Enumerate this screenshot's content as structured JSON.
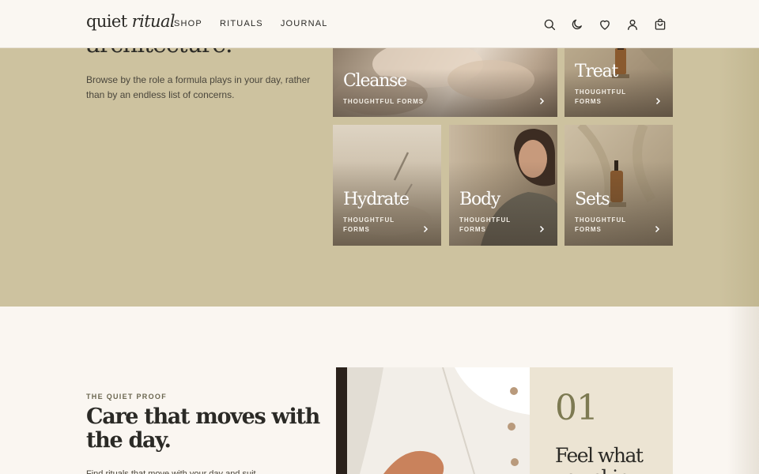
{
  "brand": {
    "name_plain": "quiet ",
    "name_italic": "ritual"
  },
  "nav": {
    "items": [
      "SHOP",
      "RITUALS",
      "JOURNAL"
    ]
  },
  "header_icons": [
    "search-icon",
    "moon-icon",
    "heart-icon",
    "user-icon",
    "bag-icon"
  ],
  "category_section": {
    "heading_fragment": "architecture.",
    "intro": "Browse by the role a formula plays in your day, rather than by an endless list of concerns.",
    "tiles": [
      {
        "title": "Cleanse",
        "subtitle": "THOUGHTFUL FORMS"
      },
      {
        "title": "Treat",
        "subtitle": "THOUGHTFUL FORMS"
      },
      {
        "title": "Hydrate",
        "subtitle": "THOUGHTFUL FORMS"
      },
      {
        "title": "Body",
        "subtitle": "THOUGHTFUL FORMS"
      },
      {
        "title": "Sets",
        "subtitle": "THOUGHTFUL FORMS"
      }
    ]
  },
  "proof_section": {
    "eyebrow": "THE QUIET PROOF",
    "title": "Care that moves with the day.",
    "body_fragment": "Find rituals that move with your day and suit",
    "feature": {
      "number": "01",
      "title": "Feel what you skin"
    }
  },
  "colors": {
    "band": "#cdc29f",
    "page": "#faf6f1",
    "card": "#ece4d3",
    "accent": "#7d7a52",
    "ink": "#2b2a26"
  }
}
